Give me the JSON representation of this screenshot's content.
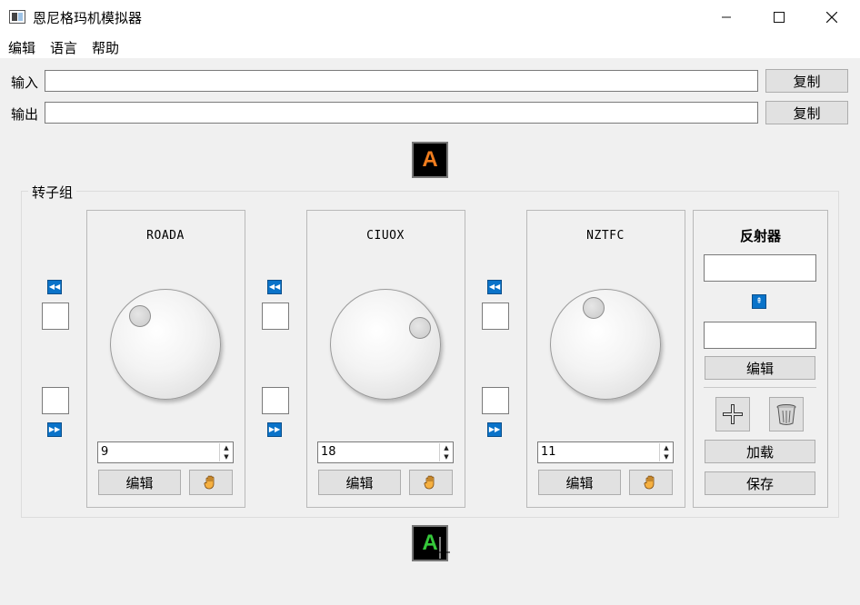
{
  "window": {
    "title": "恩尼格玛机模拟器",
    "controls": {
      "minimize": "—",
      "maximize": "☐",
      "close": "✕"
    }
  },
  "menu": {
    "items": [
      "编辑",
      "语言",
      "帮助"
    ]
  },
  "io": {
    "input_label": "输入",
    "input_value": "",
    "output_label": "输出",
    "output_value": "",
    "copy_label": "复制"
  },
  "lamps": {
    "top_letter": "A",
    "top_color": "#f07d1e",
    "bottom_letter": "A",
    "bottom_color": "#35c83a"
  },
  "rotor_group": {
    "title": "转子组",
    "rotors": [
      {
        "name": "ROADA",
        "position": "9",
        "edit_label": "编辑"
      },
      {
        "name": "CIUOX",
        "position": "18",
        "edit_label": "编辑"
      },
      {
        "name": "NZTFC",
        "position": "11",
        "edit_label": "编辑"
      }
    ]
  },
  "reflector": {
    "title": "反射器",
    "field1": "",
    "field2": "",
    "edit_label": "编辑",
    "load_label": "加载",
    "save_label": "保存"
  },
  "icons": {
    "step_back": "rewind-icon",
    "step_forward": "fast-forward-icon",
    "swap": "swap-up-icon",
    "add": "plus-icon",
    "delete": "trash-icon",
    "hand": "hand-icon"
  },
  "colors": {
    "step_button": "#0a73c9",
    "hand": "#f5b041"
  }
}
